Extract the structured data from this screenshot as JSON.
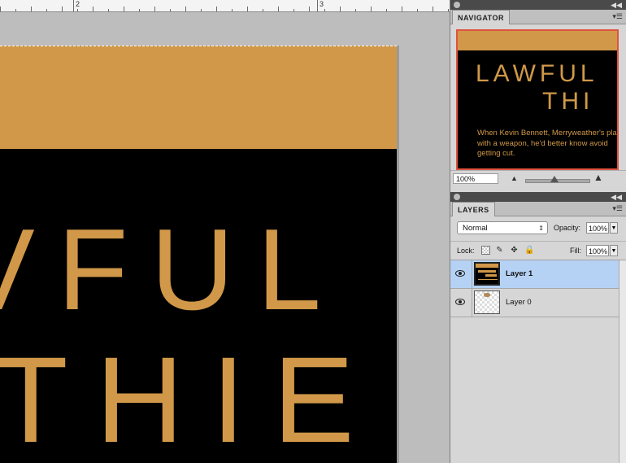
{
  "ruler": {
    "marks": [
      "2",
      "3"
    ]
  },
  "document": {
    "title_line1": "VFUL",
    "title_line2": "THIE",
    "colors": {
      "accent": "#d09848",
      "background": "#000000"
    }
  },
  "navigator": {
    "tab_label": "NAVIGATOR",
    "preview": {
      "title_line1": "LAWFUL",
      "title_line2": "THI",
      "blurb": "When Kevin Bennett, Merryweather's plays with a weapon, he'd better know avoid getting cut."
    },
    "zoom_value": "100%",
    "zoom_level_fraction": 0.45,
    "icons": {
      "zoom_out": "mountain-small-icon",
      "zoom_in": "mountain-large-icon",
      "menu": "panel-menu-icon"
    }
  },
  "layers": {
    "tab_label": "LAYERS",
    "blend_mode": "Normal",
    "opacity_label": "Opacity:",
    "opacity_value": "100%",
    "lock_label": "Lock:",
    "fill_label": "Fill:",
    "fill_value": "100%",
    "items": [
      {
        "name": "Layer 1",
        "selected": true,
        "visible": true
      },
      {
        "name": "Layer 0",
        "selected": false,
        "visible": true
      }
    ],
    "selection_color": "#b5d2f5"
  }
}
